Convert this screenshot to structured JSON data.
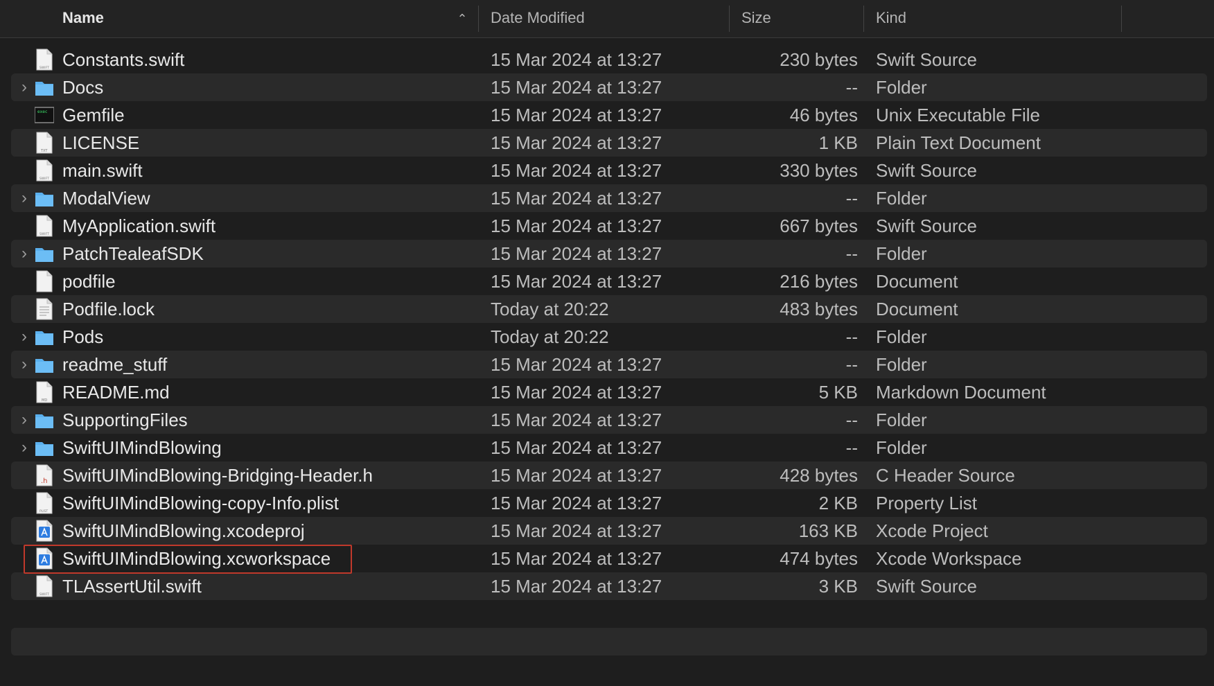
{
  "columns": {
    "name": "Name",
    "date": "Date Modified",
    "size": "Size",
    "kind": "Kind"
  },
  "rows": [
    {
      "name": "Constants.swift",
      "date": "15 Mar 2024 at 13:27",
      "size": "230 bytes",
      "kind": "Swift Source",
      "icon": "swift-file-icon",
      "folder": false
    },
    {
      "name": "Docs",
      "date": "15 Mar 2024 at 13:27",
      "size": "--",
      "kind": "Folder",
      "icon": "folder-icon",
      "folder": true
    },
    {
      "name": "Gemfile",
      "date": "15 Mar 2024 at 13:27",
      "size": "46 bytes",
      "kind": "Unix Executable File",
      "icon": "terminal-file-icon",
      "folder": false
    },
    {
      "name": "LICENSE",
      "date": "15 Mar 2024 at 13:27",
      "size": "1 KB",
      "kind": "Plain Text Document",
      "icon": "text-file-icon",
      "folder": false
    },
    {
      "name": "main.swift",
      "date": "15 Mar 2024 at 13:27",
      "size": "330 bytes",
      "kind": "Swift Source",
      "icon": "swift-file-icon",
      "folder": false
    },
    {
      "name": "ModalView",
      "date": "15 Mar 2024 at 13:27",
      "size": "--",
      "kind": "Folder",
      "icon": "folder-icon",
      "folder": true
    },
    {
      "name": "MyApplication.swift",
      "date": "15 Mar 2024 at 13:27",
      "size": "667 bytes",
      "kind": "Swift Source",
      "icon": "swift-file-icon",
      "folder": false
    },
    {
      "name": "PatchTealeafSDK",
      "date": "15 Mar 2024 at 13:27",
      "size": "--",
      "kind": "Folder",
      "icon": "folder-icon",
      "folder": true
    },
    {
      "name": "podfile",
      "date": "15 Mar 2024 at 13:27",
      "size": "216 bytes",
      "kind": "Document",
      "icon": "blank-file-icon",
      "folder": false
    },
    {
      "name": "Podfile.lock",
      "date": "Today at 20:22",
      "size": "483 bytes",
      "kind": "Document",
      "icon": "lined-file-icon",
      "folder": false
    },
    {
      "name": "Pods",
      "date": "Today at 20:22",
      "size": "--",
      "kind": "Folder",
      "icon": "folder-icon",
      "folder": true
    },
    {
      "name": "readme_stuff",
      "date": "15 Mar 2024 at 13:27",
      "size": "--",
      "kind": "Folder",
      "icon": "folder-icon",
      "folder": true
    },
    {
      "name": "README.md",
      "date": "15 Mar 2024 at 13:27",
      "size": "5 KB",
      "kind": "Markdown Document",
      "icon": "markdown-file-icon",
      "folder": false
    },
    {
      "name": "SupportingFiles",
      "date": "15 Mar 2024 at 13:27",
      "size": "--",
      "kind": "Folder",
      "icon": "folder-icon",
      "folder": true
    },
    {
      "name": "SwiftUIMindBlowing",
      "date": "15 Mar 2024 at 13:27",
      "size": "--",
      "kind": "Folder",
      "icon": "folder-icon",
      "folder": true
    },
    {
      "name": "SwiftUIMindBlowing-Bridging-Header.h",
      "date": "15 Mar 2024 at 13:27",
      "size": "428 bytes",
      "kind": "C Header Source",
      "icon": "header-file-icon",
      "folder": false
    },
    {
      "name": "SwiftUIMindBlowing-copy-Info.plist",
      "date": "15 Mar 2024 at 13:27",
      "size": "2 KB",
      "kind": "Property List",
      "icon": "plist-file-icon",
      "folder": false
    },
    {
      "name": "SwiftUIMindBlowing.xcodeproj",
      "date": "15 Mar 2024 at 13:27",
      "size": "163 KB",
      "kind": "Xcode Project",
      "icon": "xcode-project-icon",
      "folder": false
    },
    {
      "name": "SwiftUIMindBlowing.xcworkspace",
      "date": "15 Mar 2024 at 13:27",
      "size": "474 bytes",
      "kind": "Xcode Workspace",
      "icon": "xcode-workspace-icon",
      "folder": false
    },
    {
      "name": "TLAssertUtil.swift",
      "date": "15 Mar 2024 at 13:27",
      "size": "3 KB",
      "kind": "Swift Source",
      "icon": "swift-file-icon",
      "folder": false
    }
  ],
  "icon_labels": {
    "swift": "SWIFT",
    "txt": "TXT",
    "md": "MD",
    "h": ".h",
    "plist": "PLIST"
  },
  "colors": {
    "background": "#1e1e1e",
    "row_alt": "#2a2a2a",
    "folder": "#5ab0ee",
    "highlight": "#c0392b"
  }
}
